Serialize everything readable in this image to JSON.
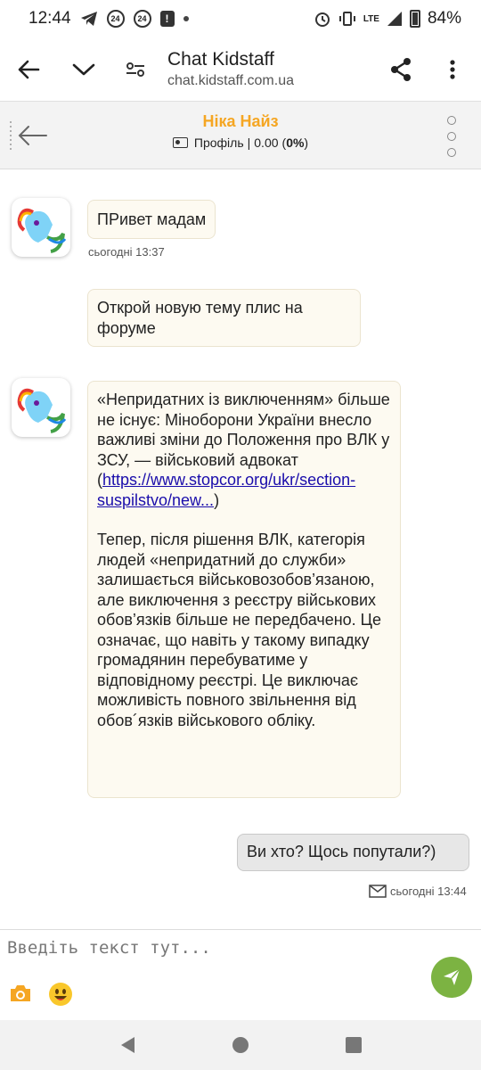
{
  "status_bar": {
    "time": "12:44",
    "battery": "84%",
    "network": "LTE",
    "badge1": "24",
    "badge2": "24",
    "alert": "!"
  },
  "app_bar": {
    "title": "Chat Kidstaff",
    "url": "chat.kidstaff.com.ua"
  },
  "chat_header": {
    "name": "Ніка Найз",
    "profile_label": "Профіль",
    "separator": "|",
    "balance": "0.00",
    "percent_prefix": "(",
    "percent": "0%",
    "percent_suffix": ")"
  },
  "messages": {
    "m1": {
      "text": "ПРивет мадам",
      "time": "сьогодні 13:37"
    },
    "m2": {
      "text": "Открой новую тему плис на форуме"
    },
    "m3": {
      "para1": "«Непридатних із виключенням» більше не існує: Міноборони України внесло важливі зміни до Положення про ВЛК у ЗСУ, — військовий адвокат",
      "link_open": "(",
      "link": "https://www.stopcor.org/ukr/section-suspilstvo/new...",
      "link_close": ")",
      "para2": "Тепер, після рішення ВЛК, категорія людей «непридатний до служби» залишається військовозобов’язаною, але виключення з реєстру військових обов’язків більше не передбачено. Це означає, що навіть у такому випадку громадянин перебуватиме у відповідному реєстрі. Це виключає можливість повного звільнення від обов´язків військового обліку."
    },
    "m4": {
      "text": "Ви хто? Щось попутали?)",
      "time": "сьогодні 13:44"
    }
  },
  "composer": {
    "placeholder": "Введіть текст тут..."
  },
  "colors": {
    "accent_name": "#f5a623",
    "send": "#7cb342",
    "camera": "#f5a623"
  }
}
